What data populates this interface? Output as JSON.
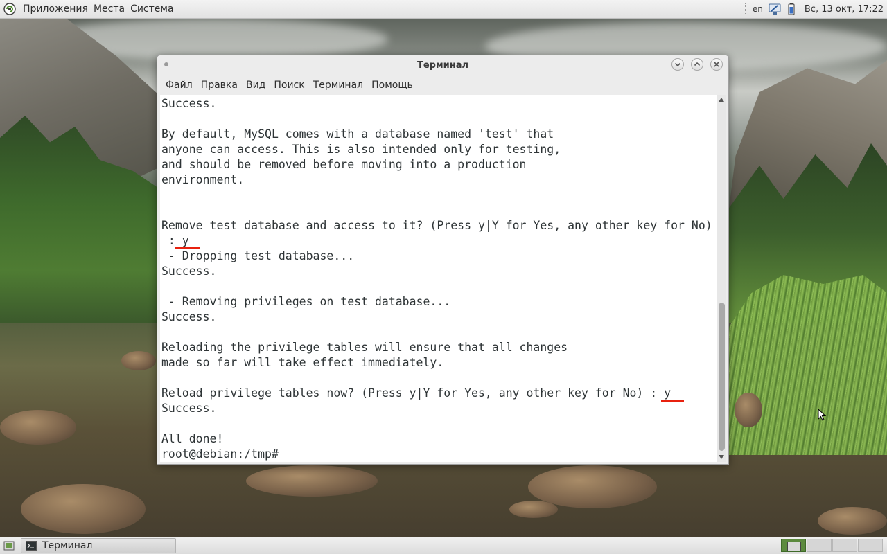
{
  "top_panel": {
    "menus": [
      "Приложения",
      "Места",
      "Система"
    ],
    "language": "en",
    "clock": "Вс, 13 окт, 17:22"
  },
  "window": {
    "title": "Терминал",
    "menubar": [
      "Файл",
      "Правка",
      "Вид",
      "Поиск",
      "Терминал",
      "Помощь"
    ]
  },
  "terminal": {
    "output": "Success.\n\nBy default, MySQL comes with a database named 'test' that\nanyone can access. This is also intended only for testing,\nand should be removed before moving into a production\nenvironment.\n\n\nRemove test database and access to it? (Press y|Y for Yes, any other key for No)\n : y\n - Dropping test database...\nSuccess.\n\n - Removing privileges on test database...\nSuccess.\n\nReloading the privilege tables will ensure that all changes\nmade so far will take effect immediately.\n\nReload privilege tables now? (Press y|Y for Yes, any other key for No) : y\nSuccess.\n\nAll done!\nroot@debian:/tmp# "
  },
  "taskbar": {
    "task_label": "Терминал"
  },
  "colors": {
    "annotation_underline": "#e8210f",
    "workspace_active": "#5c8a3e"
  }
}
